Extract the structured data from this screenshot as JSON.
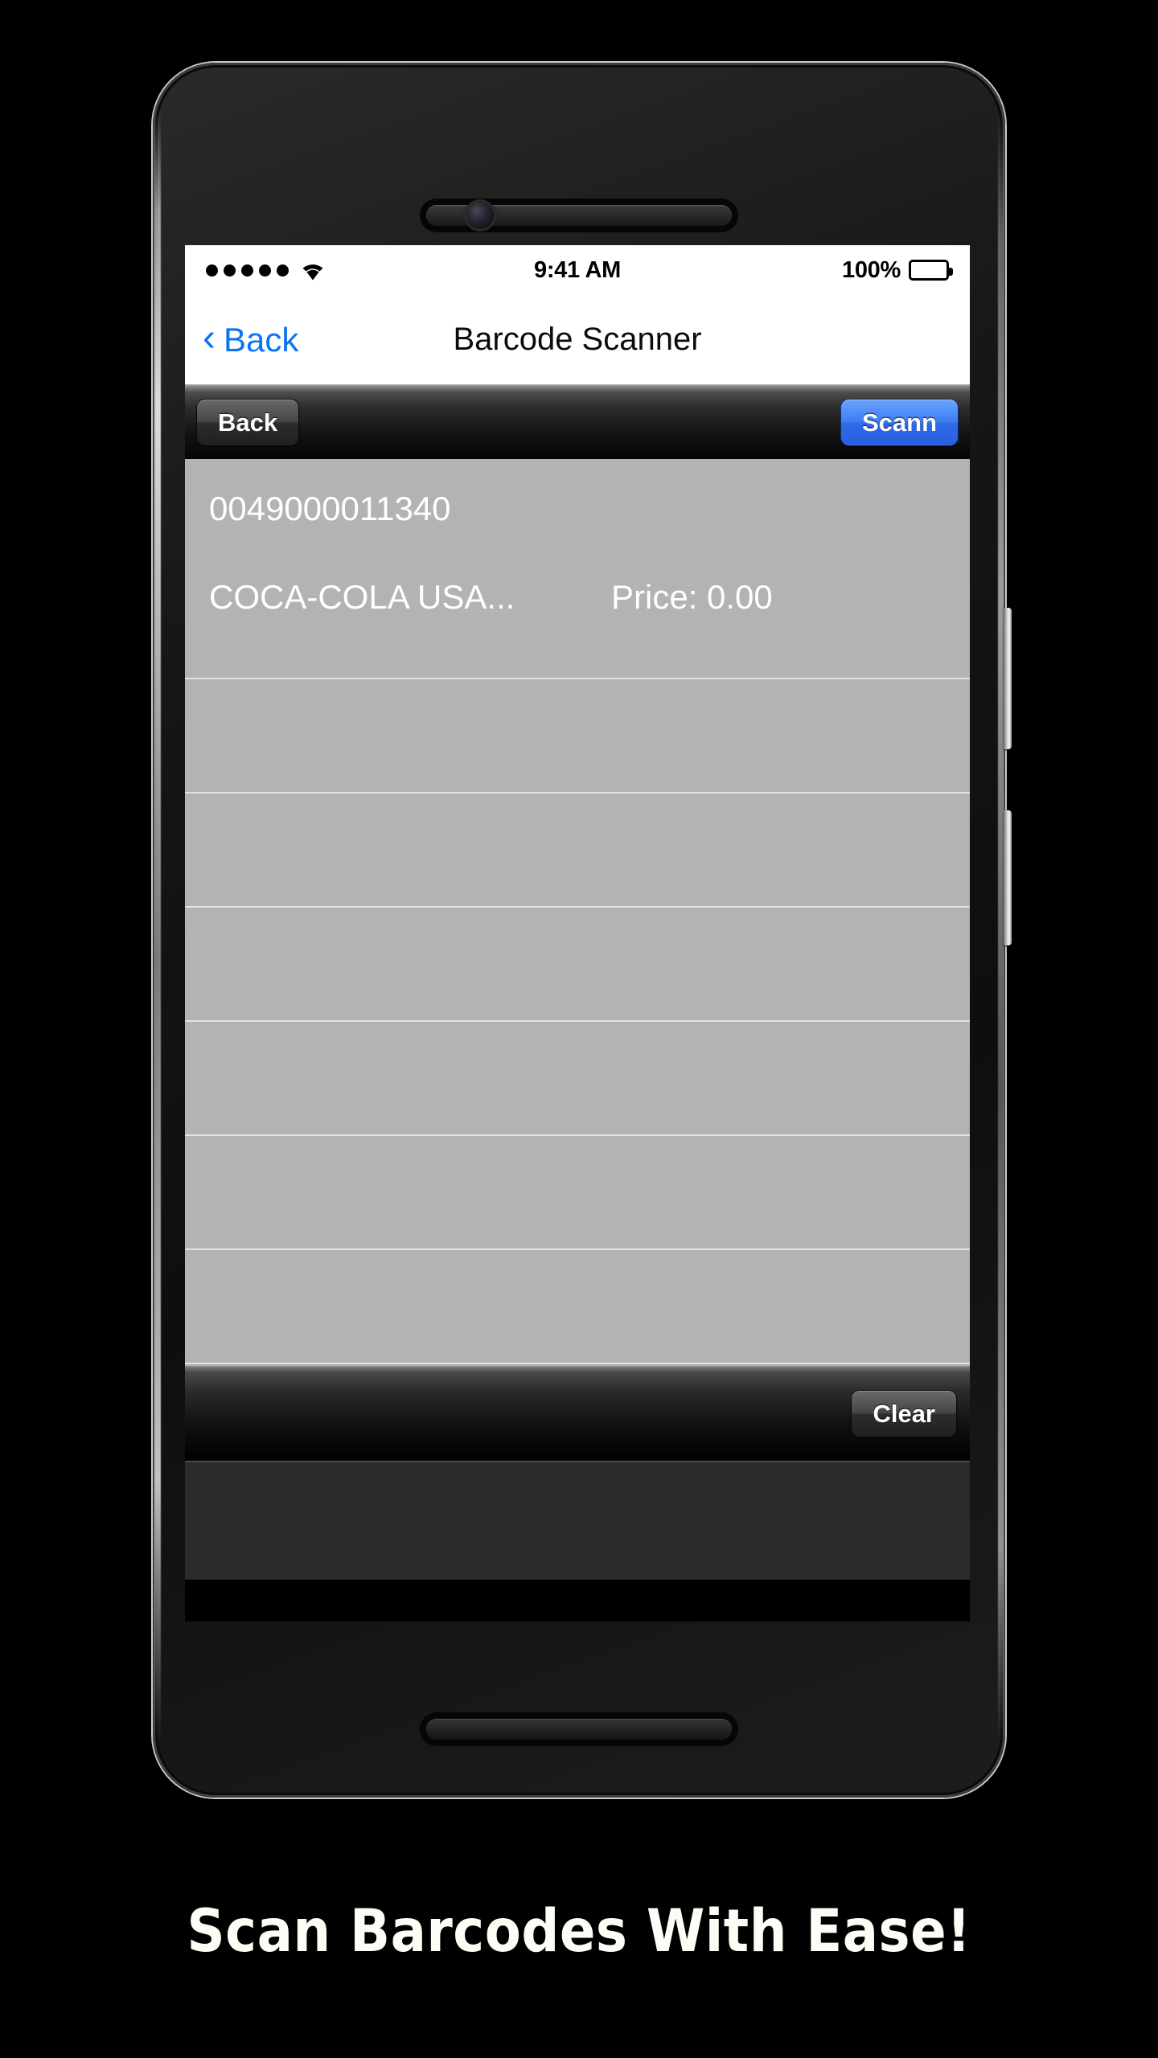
{
  "caption": "Scan Barcodes With Ease!",
  "device": {
    "front_camera": "front-camera",
    "earpiece": "earpiece-speaker",
    "bottom_speaker": "bottom-speaker"
  },
  "status_bar": {
    "signal_dots": 5,
    "wifi": "wifi-icon",
    "time": "9:41 AM",
    "battery_percent": "100%",
    "battery_level": 100
  },
  "nav_bar": {
    "back_label": "Back",
    "back_chevron": "‹",
    "title": "Barcode Scanner"
  },
  "app_toolbar": {
    "back_label": "Back",
    "scan_label": "Scann"
  },
  "list": {
    "columns": [
      "barcode",
      "name",
      "price"
    ],
    "rows": [
      {
        "barcode": "0049000011340",
        "name": "COCA-COLA USA...",
        "price": "Price: 0.00",
        "empty": false
      },
      {
        "barcode": "",
        "name": "",
        "price": "",
        "empty": true
      },
      {
        "barcode": "",
        "name": "",
        "price": "",
        "empty": true
      },
      {
        "barcode": "",
        "name": "",
        "price": "",
        "empty": true
      },
      {
        "barcode": "",
        "name": "",
        "price": "",
        "empty": true
      },
      {
        "barcode": "",
        "name": "",
        "price": "",
        "empty": true
      },
      {
        "barcode": "",
        "name": "",
        "price": "",
        "empty": true
      }
    ]
  },
  "bottom_toolbar": {
    "clear_label": "Clear"
  },
  "colors": {
    "page_background": "#000000",
    "screen_background": "#000000",
    "status_bar_background": "#ffffff",
    "nav_bar_background": "#ffffff",
    "nav_tint": "#0a74f0",
    "list_background": "#b3b3b3",
    "list_separator": "#e3e3e3",
    "list_text": "#ffffff",
    "scan_button": "#3d7ef5",
    "toolbar_button": "#454545",
    "caption_text": "#fdfdf6"
  }
}
